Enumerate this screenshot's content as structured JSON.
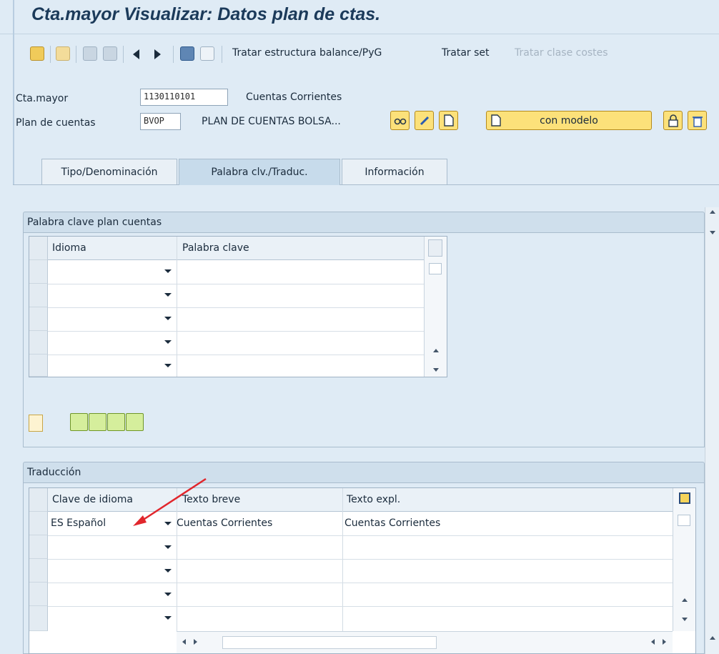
{
  "window": {
    "title": "Cta.mayor Visualizar: Datos plan de ctas."
  },
  "toolbar": {
    "icons": [
      "display-change-icon",
      "other-object-icon",
      "undo-icon",
      "redo-icon",
      "previous-icon",
      "next-icon",
      "overview-icon",
      "document-icon"
    ],
    "btn_balance": "Tratar estructura balance/PyG",
    "btn_set": "Tratar set",
    "btn_cost_class": "Tratar clase costes"
  },
  "header": {
    "gl_account_label": "Cta.mayor",
    "gl_account_value": "1130110101",
    "gl_account_desc": "Cuentas Corrientes",
    "chart_label": "Plan de cuentas",
    "chart_value": "BVOP",
    "chart_desc": "PLAN DE CUENTAS BOLSA...",
    "model_button": "con modelo"
  },
  "tabs": [
    {
      "label": "Tipo/Denominación",
      "active": false
    },
    {
      "label": "Palabra clv./Traduc.",
      "active": true
    },
    {
      "label": "Información",
      "active": false
    }
  ],
  "keywords": {
    "group_title": "Palabra clave plan cuentas",
    "columns": [
      "Idioma",
      "Palabra clave"
    ],
    "rows": [
      {
        "language": "",
        "keyword": ""
      },
      {
        "language": "",
        "keyword": ""
      },
      {
        "language": "",
        "keyword": ""
      },
      {
        "language": "",
        "keyword": ""
      },
      {
        "language": "",
        "keyword": ""
      }
    ]
  },
  "translation": {
    "group_title": "Traducción",
    "columns": [
      "Clave de idioma",
      "Texto breve",
      "Texto expl."
    ],
    "rows": [
      {
        "language": "ES Español",
        "short_text": "Cuentas Corrientes",
        "long_text": "Cuentas Corrientes"
      },
      {
        "language": "",
        "short_text": "",
        "long_text": ""
      },
      {
        "language": "",
        "short_text": "",
        "long_text": ""
      },
      {
        "language": "",
        "short_text": "",
        "long_text": ""
      },
      {
        "language": "",
        "short_text": "",
        "long_text": ""
      }
    ]
  },
  "colors": {
    "background": "#dfebf5",
    "button_yellow": "#fce17a",
    "button_green": "#d5ee9c",
    "annotation_arrow": "#e1262c"
  }
}
